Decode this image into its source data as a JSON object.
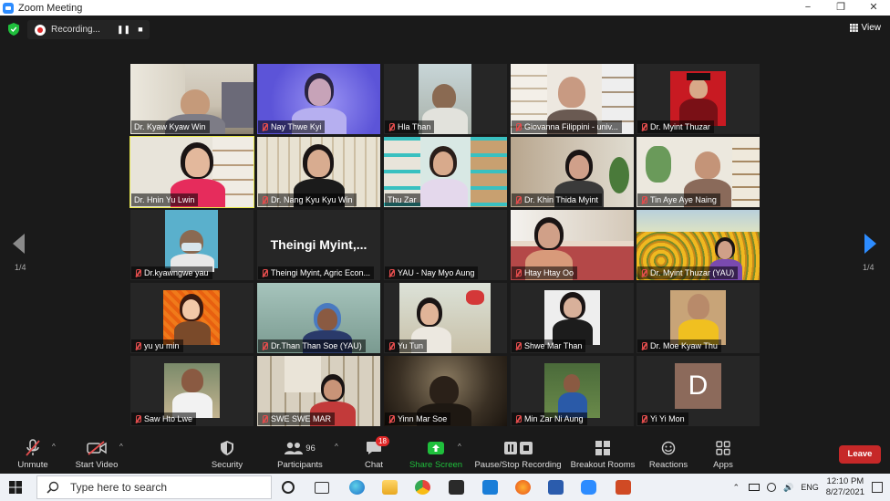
{
  "window": {
    "title": "Zoom Meeting",
    "minimize": "−",
    "restore": "❐",
    "close": "✕"
  },
  "recording": {
    "label": "Recording...",
    "pause": "❚❚",
    "stop": "■"
  },
  "view_label": "View",
  "page_indicator": {
    "left": "1/4",
    "right": "1/4"
  },
  "participants": [
    {
      "name": "Dr. Kyaw Kyaw Win",
      "muted": false
    },
    {
      "name": "Nay Thwe Kyi",
      "muted": true
    },
    {
      "name": "Hla Than",
      "muted": true
    },
    {
      "name": "Giovanna Filippini - univ...",
      "muted": true
    },
    {
      "name": "Dr. Myint Thuzar",
      "muted": true
    },
    {
      "name": "Dr. Hnin Yu Lwin",
      "muted": false
    },
    {
      "name": "Dr. Nang Kyu Kyu Win",
      "muted": true
    },
    {
      "name": "Thu Zar",
      "muted": false
    },
    {
      "name": "Dr. Khin Thida Myint",
      "muted": true
    },
    {
      "name": "Tin Aye Aye Naing",
      "muted": true
    },
    {
      "name": "Dr.kyawngwe yau",
      "muted": true
    },
    {
      "name": "Theingi Myint, Agric Econ...",
      "muted": true,
      "display": "Theingi  Myint,..."
    },
    {
      "name": "YAU - Nay Myo Aung",
      "muted": true
    },
    {
      "name": "Htay Htay Oo",
      "muted": true
    },
    {
      "name": "Dr. Myint Thuzar (YAU)",
      "muted": true
    },
    {
      "name": "yu yu min",
      "muted": true
    },
    {
      "name": "Dr.Than Than Soe (YAU)",
      "muted": true
    },
    {
      "name": "Yu Tun",
      "muted": true
    },
    {
      "name": "Shwe Mar Than",
      "muted": true
    },
    {
      "name": "Dr. Moe Kyaw Thu",
      "muted": true
    },
    {
      "name": "Saw Hto Lwe",
      "muted": true
    },
    {
      "name": "SWE SWE MAR",
      "muted": true
    },
    {
      "name": "Yinn Mar Soe",
      "muted": true
    },
    {
      "name": "Min Zar Ni Aung",
      "muted": true
    },
    {
      "name": "Yi Yi Mon",
      "muted": true,
      "avatar_letter": "D"
    }
  ],
  "toolbar": {
    "unmute": "Unmute",
    "start_video": "Start Video",
    "security": "Security",
    "participants": "Participants",
    "participants_count": "96",
    "chat": "Chat",
    "chat_badge": "18",
    "share_screen": "Share Screen",
    "pause_recording": "Pause/Stop Recording",
    "breakout_rooms": "Breakout Rooms",
    "reactions": "Reactions",
    "apps": "Apps",
    "leave": "Leave",
    "caret": "^"
  },
  "taskbar": {
    "search_placeholder": "Type here to search",
    "language": "ENG",
    "time": "12:10 PM",
    "date": "8/27/2021"
  },
  "colors": {
    "share_green": "#1fbf3c",
    "leave_red": "#c62828",
    "active_speaker": "#e8e84a",
    "muted_red": "#e34d4d",
    "arrow_grey": "#8a8a8a",
    "arrow_blue": "#2d8cff"
  }
}
